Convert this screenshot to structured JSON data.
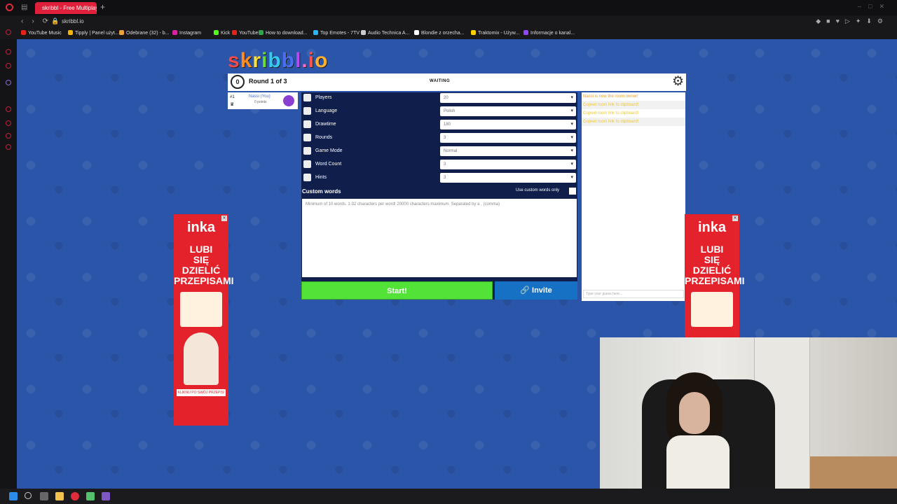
{
  "browser": {
    "tab_title": "skribbl - Free Multiplayer",
    "new_tab": "+",
    "url": "skribbl.io",
    "bookmarks": [
      {
        "label": "YouTube Music",
        "color": "#e62117"
      },
      {
        "label": "Tipply | Panel użyt...",
        "color": "#f5b400"
      },
      {
        "label": "Odebrane (32) - b...",
        "color": "#e8a33d"
      },
      {
        "label": "Instagram",
        "color": "#d6249f"
      },
      {
        "label": "Kick",
        "color": "#53fc18"
      },
      {
        "label": "YouTube",
        "color": "#e62117"
      },
      {
        "label": "How to download...",
        "color": "#2ea44f"
      },
      {
        "label": "Top Emotes - 7TV",
        "color": "#29b6f6"
      },
      {
        "label": "Audio Technica A...",
        "color": "#cccccc"
      },
      {
        "label": "Blondie z orzecha...",
        "color": "#ffffff"
      },
      {
        "label": "Traktomix - Używ...",
        "color": "#ffd000"
      },
      {
        "label": "Informacje o kanal...",
        "color": "#9147ff"
      }
    ]
  },
  "game": {
    "logo": "skribbl.io",
    "logo_letters": [
      {
        "ch": "s",
        "color": "#f04a4a"
      },
      {
        "ch": "k",
        "color": "#ff8a1e"
      },
      {
        "ch": "r",
        "color": "#ffe03a"
      },
      {
        "ch": "i",
        "color": "#6ddb35"
      },
      {
        "ch": "b",
        "color": "#35c8f0"
      },
      {
        "ch": "b",
        "color": "#4a6ef0"
      },
      {
        "ch": "l",
        "color": "#b44af0"
      },
      {
        "ch": ".",
        "color": "#ff6ac0"
      },
      {
        "ch": "i",
        "color": "#ff5050"
      },
      {
        "ch": "o",
        "color": "#ffb030"
      }
    ],
    "timer": "0",
    "round": "Round 1 of 3",
    "status": "WAITING",
    "player": {
      "rank": "#1",
      "name": "Nassi (You)",
      "points": "0 points"
    },
    "settings": [
      {
        "label": "Players",
        "value": "20"
      },
      {
        "label": "Language",
        "value": "Polish"
      },
      {
        "label": "Drawtime",
        "value": "180"
      },
      {
        "label": "Rounds",
        "value": "3"
      },
      {
        "label": "Game Mode",
        "value": "Normal"
      },
      {
        "label": "Word Count",
        "value": "3"
      },
      {
        "label": "Hints",
        "value": "3"
      }
    ],
    "custom_words": {
      "label": "Custom words",
      "only_label": "Use custom words only",
      "placeholder": "Minimum of 10 words. 1-32 characters per word! 20000 characters maximum. Separated by a , (comma)"
    },
    "start_label": "Start!",
    "invite_label": "Invite",
    "chat": {
      "messages": [
        {
          "text": "Nassi is now the room owner!",
          "color": "#f0a020"
        },
        {
          "text": "Copied room link to clipboard!",
          "color": "#f0c830"
        },
        {
          "text": "Copied room link to clipboard!",
          "color": "#f0c830"
        },
        {
          "text": "Copied room link to clipboard!",
          "color": "#f0c830"
        }
      ],
      "placeholder": "Type your guess here..."
    }
  },
  "ads": {
    "brand": "inka",
    "headline_1": "LUBI",
    "headline_2": "SIĘ DZIELIĆ",
    "headline_3": "PRZEPISAMI",
    "cta": "KLIKNIJ PO SWÓJ PRZEPIS!"
  }
}
